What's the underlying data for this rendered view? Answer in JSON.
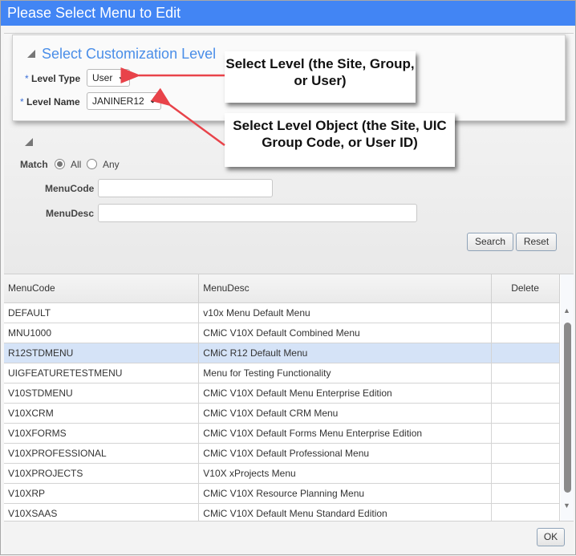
{
  "dialog": {
    "title": "Please Select Menu to Edit"
  },
  "level_panel": {
    "title": "Select Customization Level",
    "required_marker": "*",
    "level_type_label": "Level Type",
    "level_type_value": "User",
    "level_name_label": "Level Name",
    "level_name_value": "JANINER12"
  },
  "callouts": {
    "level": "Select Level (the Site, Group, or User)",
    "level_object": "Select Level Object (the Site, UIC Group Code, or User ID)"
  },
  "search": {
    "match_label": "Match",
    "match_options": [
      "All",
      "Any"
    ],
    "match_selected": "All",
    "menucode_label": "MenuCode",
    "menucode_value": "",
    "menudesc_label": "MenuDesc",
    "menudesc_value": "",
    "search_button": "Search",
    "reset_button": "Reset"
  },
  "table": {
    "columns": [
      "MenuCode",
      "MenuDesc",
      "Delete"
    ],
    "selected_row": 2,
    "rows": [
      {
        "code": "DEFAULT",
        "desc": "v10x Menu Default Menu"
      },
      {
        "code": "MNU1000",
        "desc": "CMiC V10X Default Combined Menu"
      },
      {
        "code": "R12STDMENU",
        "desc": "CMiC R12 Default Menu"
      },
      {
        "code": "UIGFEATURETESTMENU",
        "desc": "Menu for Testing Functionality"
      },
      {
        "code": "V10STDMENU",
        "desc": "CMiC V10X Default Menu Enterprise Edition"
      },
      {
        "code": "V10XCRM",
        "desc": "CMiC V10X Default CRM Menu"
      },
      {
        "code": "V10XFORMS",
        "desc": "CMiC V10X Default Forms Menu Enterprise Edition"
      },
      {
        "code": "V10XPROFESSIONAL",
        "desc": "CMiC V10X Default Professional Menu"
      },
      {
        "code": "V10XPROJECTS",
        "desc": "V10X xProjects Menu"
      },
      {
        "code": "V10XRP",
        "desc": "CMiC V10X Resource Planning Menu"
      },
      {
        "code": "V10XSAAS",
        "desc": "CMiC V10X Default Menu Standard Edition"
      }
    ]
  },
  "footer": {
    "ok_button": "OK"
  },
  "colors": {
    "titlebar": "#4285f4",
    "section_title": "#4a8ee8",
    "selected_row": "#d5e3f7",
    "annotation_arrow": "#e8434a"
  }
}
